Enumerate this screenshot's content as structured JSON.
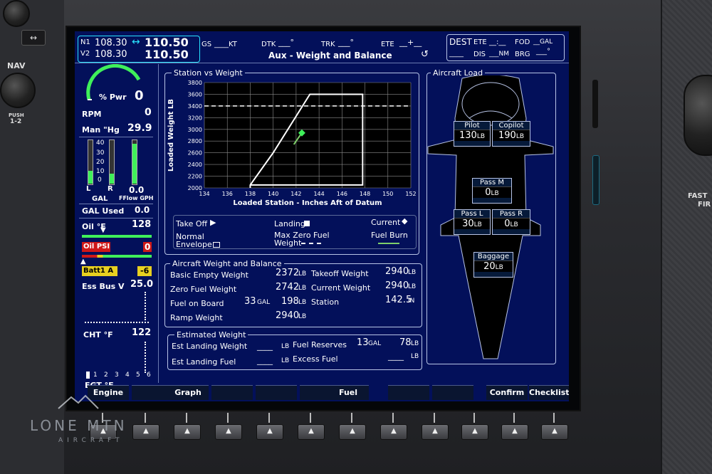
{
  "hardware": {
    "nav_label": "NAV",
    "push_label": "PUSH",
    "push_sub": "1-2",
    "fast_label": "FAST",
    "fast_sub": "FIR",
    "swap_glyph": "↔",
    "bottom_key_glyph": "▲",
    "watermark_name": "LONE MTN",
    "watermark_sub": "AIRCRAFT"
  },
  "topbar": {
    "nav1_label": "N1",
    "nav1_active": "108.30",
    "nav1_swap": "↔",
    "nav1_standby": "110.50",
    "nav2_label": "V2",
    "nav2_active": "108.30",
    "nav2_standby": "110.50",
    "gs_label": "GS",
    "gs_value": "____KT",
    "dtk_label": "DTK",
    "dtk_value": "___°",
    "trk_label": "TRK",
    "trk_value": "___°",
    "ete_label": "ETE",
    "ete_value": "__+__",
    "page_title": "Aux - Weight and Balance",
    "dest_label": "DEST",
    "dest_ete_label": "ETE",
    "dest_ete_value": "__:__",
    "fod_label": "FOD",
    "fod_value": "__GAL",
    "dis_value": "____",
    "dis_label": "DIS",
    "dis_unit": "___NM",
    "brg_label": "BRG",
    "brg_value": "___°"
  },
  "engine": {
    "pwr_label": "% Pwr",
    "pwr_value": "0",
    "rpm_label": "RPM",
    "rpm_value": "0",
    "man_label": "Man \"Hg",
    "man_value": "29.9",
    "fuel_scale": [
      "40",
      "30",
      "20",
      "10",
      "0"
    ],
    "fuel_l": "L",
    "fuel_r": "R",
    "fuel_gal": "GAL",
    "fflow_value": "0.0",
    "fflow_label": "FFlow GPH",
    "gal_used_label": "GAL Used",
    "gal_used_value": "0.0",
    "oil_f_label": "Oil °F",
    "oil_f_value": "128",
    "oil_psi_label": "Oil PSI",
    "oil_psi_value": "0",
    "batt_label": "Batt1 A",
    "batt_value": "-6",
    "ess_label": "Ess Bus V",
    "ess_value": "25.0",
    "cht_label": "CHT °F",
    "cht_value": "122",
    "cyl_numbers": [
      "1",
      "2",
      "3",
      "4",
      "5",
      "6"
    ],
    "egt_label": "EGT °F"
  },
  "station_panel": {
    "title": "Station vs Weight",
    "legend_takeoff": "Take Off",
    "legend_landing": "Landing",
    "legend_current": "Current",
    "legend_normal": "Normal",
    "legend_envelope": "Envelope",
    "legend_maxzero": "Max Zero Fuel",
    "legend_weight": "Weight",
    "legend_fuelburn": "Fuel Burn"
  },
  "chart_data": {
    "type": "line",
    "title": "",
    "xlabel": "Loaded Station - Inches Aft of Datum",
    "ylabel": "Loaded Weight LB",
    "xlim": [
      134,
      152
    ],
    "ylim": [
      2000,
      3800
    ],
    "x_ticks": [
      "134",
      "136",
      "138",
      "140",
      "142",
      "144",
      "146",
      "148",
      "150",
      "152"
    ],
    "y_ticks": [
      "2000",
      "2200",
      "2400",
      "2600",
      "2800",
      "3000",
      "3200",
      "3400",
      "3600",
      "3800"
    ],
    "grid": true,
    "series": [
      {
        "name": "Normal Envelope",
        "x": [
          138,
          138,
          140,
          143.2,
          147.8,
          147.8,
          138
        ],
        "y": [
          2000,
          2050,
          2600,
          3600,
          3600,
          2050,
          2050
        ]
      },
      {
        "name": "Max Zero Fuel Weight",
        "x": [
          134,
          152
        ],
        "y": [
          3400,
          3400
        ]
      },
      {
        "name": "Fuel Burn",
        "x": [
          141.8,
          142.5
        ],
        "y": [
          2742,
          2940
        ]
      }
    ],
    "markers": [
      {
        "name": "Current",
        "x": 142.5,
        "y": 2940
      }
    ]
  },
  "awb": {
    "title": "Aircraft Weight and Balance",
    "basic_empty_label": "Basic Empty Weight",
    "basic_empty_value": "2372",
    "lb": "LB",
    "takeoff_label": "Takeoff Weight",
    "takeoff_value": "2940",
    "zero_fuel_label": "Zero Fuel Weight",
    "zero_fuel_value": "2742",
    "current_label": "Current Weight",
    "current_value": "2940",
    "fob_label": "Fuel on Board",
    "fob_gal": "33",
    "gal": "GAL",
    "fob_lb": "198",
    "station_label": "Station",
    "station_value": "142.5",
    "in": "IN",
    "ramp_label": "Ramp Weight",
    "ramp_value": "2940"
  },
  "est": {
    "title": "Estimated Weight",
    "landing_weight_label": "Est Landing Weight",
    "landing_weight_value": "____",
    "reserves_label": "Fuel Reserves",
    "reserves_gal": "13",
    "reserves_lb": "78",
    "landing_fuel_label": "Est Landing Fuel",
    "landing_fuel_value": "____",
    "excess_label": "Excess Fuel",
    "excess_value": "____"
  },
  "load": {
    "title": "Aircraft Load",
    "pilot_label": "Pilot",
    "pilot_value": "130",
    "copilot_label": "Copilot",
    "copilot_value": "190",
    "passm_label": "Pass M",
    "passm_value": "0",
    "passl_label": "Pass L",
    "passl_value": "30",
    "passr_label": "Pass R",
    "passr_value": "0",
    "baggage_label": "Baggage",
    "baggage_value": "20"
  },
  "softkeys": [
    "Engine",
    "",
    "Graph",
    "",
    "",
    "",
    "Fuel",
    "",
    "",
    "Confirm",
    "Checklist"
  ]
}
